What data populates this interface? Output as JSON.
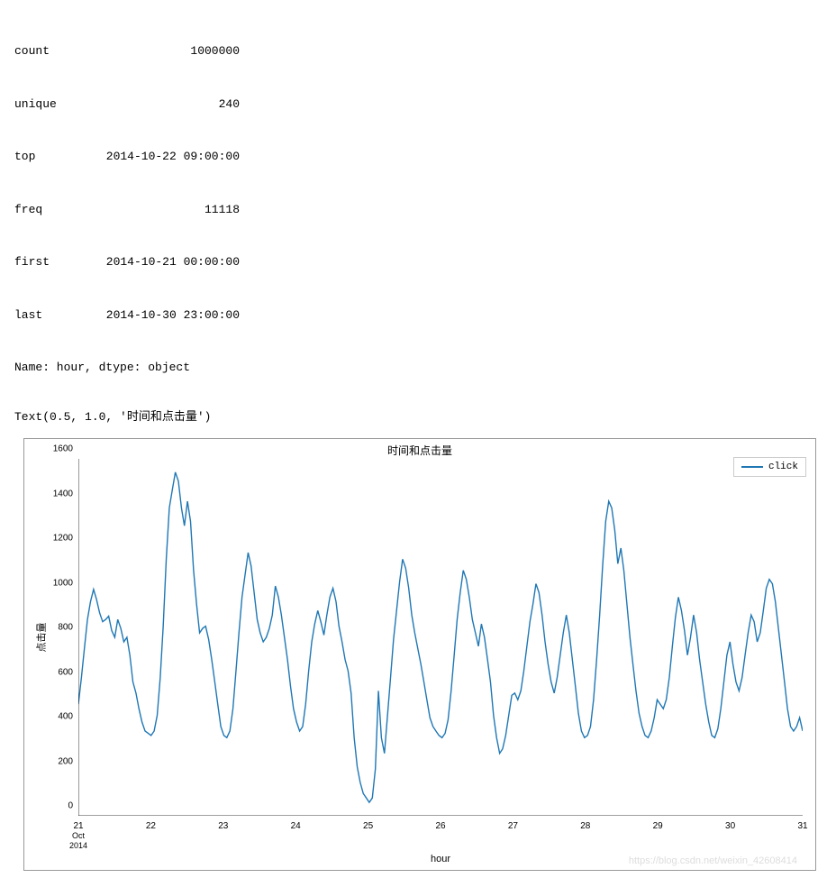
{
  "stats": {
    "count_key": "count",
    "count_val": "1000000",
    "unique_key": "unique",
    "unique_val": "240",
    "top_key": "top",
    "top_val": "2014-10-22 09:00:00",
    "freq_key": "freq",
    "freq_val": "11118",
    "first_key": "first",
    "first_val": "2014-10-21 00:00:00",
    "last_key": "last",
    "last_val": "2014-10-30 23:00:00",
    "name_line": "Name: hour, dtype: object"
  },
  "text_output": "Text(0.5, 1.0, '时间和点击量')",
  "chart": {
    "title": "时间和点击量",
    "xlabel": "hour",
    "ylabel": "点击量",
    "legend_label": "click",
    "watermark": "https://blog.csdn.net/weixin_42608414"
  },
  "chart_data": {
    "type": "line",
    "title": "时间和点击量",
    "xlabel": "hour",
    "ylabel": "点击量",
    "ylim": [
      0,
      1600
    ],
    "xlim": [
      "2014-10-21",
      "2014-10-31"
    ],
    "y_ticks": [
      0,
      200,
      400,
      600,
      800,
      1000,
      1200,
      1400,
      1600
    ],
    "x_ticks": [
      "21",
      "22",
      "23",
      "24",
      "25",
      "26",
      "27",
      "28",
      "29",
      "30",
      "31"
    ],
    "x_tick_sub": [
      "Oct",
      "2014"
    ],
    "series": [
      {
        "name": "click",
        "color": "#1f77b4",
        "x": [
          0,
          1,
          2,
          3,
          4,
          5,
          6,
          7,
          8,
          9,
          10,
          11,
          12,
          13,
          14,
          15,
          16,
          17,
          18,
          19,
          20,
          21,
          22,
          23,
          24,
          25,
          26,
          27,
          28,
          29,
          30,
          31,
          32,
          33,
          34,
          35,
          36,
          37,
          38,
          39,
          40,
          41,
          42,
          43,
          44,
          45,
          46,
          47,
          48,
          49,
          50,
          51,
          52,
          53,
          54,
          55,
          56,
          57,
          58,
          59,
          60,
          61,
          62,
          63,
          64,
          65,
          66,
          67,
          68,
          69,
          70,
          71,
          72,
          73,
          74,
          75,
          76,
          77,
          78,
          79,
          80,
          81,
          82,
          83,
          84,
          85,
          86,
          87,
          88,
          89,
          90,
          91,
          92,
          93,
          94,
          95,
          96,
          97,
          98,
          99,
          100,
          101,
          102,
          103,
          104,
          105,
          106,
          107,
          108,
          109,
          110,
          111,
          112,
          113,
          114,
          115,
          116,
          117,
          118,
          119,
          120,
          121,
          122,
          123,
          124,
          125,
          126,
          127,
          128,
          129,
          130,
          131,
          132,
          133,
          134,
          135,
          136,
          137,
          138,
          139,
          140,
          141,
          142,
          143,
          144,
          145,
          146,
          147,
          148,
          149,
          150,
          151,
          152,
          153,
          154,
          155,
          156,
          157,
          158,
          159,
          160,
          161,
          162,
          163,
          164,
          165,
          166,
          167,
          168,
          169,
          170,
          171,
          172,
          173,
          174,
          175,
          176,
          177,
          178,
          179,
          180,
          181,
          182,
          183,
          184,
          185,
          186,
          187,
          188,
          189,
          190,
          191,
          192,
          193,
          194,
          195,
          196,
          197,
          198,
          199,
          200,
          201,
          202,
          203,
          204,
          205,
          206,
          207,
          208,
          209,
          210,
          211,
          212,
          213,
          214,
          215,
          216,
          217,
          218,
          219,
          220,
          221,
          222,
          223,
          224,
          225,
          226,
          227,
          228,
          229,
          230,
          231,
          232,
          233,
          234,
          235,
          236,
          237,
          238,
          239
        ],
        "values": [
          500,
          620,
          750,
          880,
          960,
          1015,
          970,
          910,
          870,
          880,
          895,
          830,
          800,
          880,
          840,
          780,
          800,
          720,
          600,
          550,
          480,
          420,
          380,
          370,
          360,
          380,
          450,
          620,
          850,
          1150,
          1380,
          1460,
          1540,
          1500,
          1380,
          1300,
          1410,
          1320,
          1100,
          950,
          820,
          840,
          850,
          790,
          700,
          600,
          500,
          400,
          360,
          350,
          380,
          480,
          650,
          820,
          980,
          1080,
          1180,
          1120,
          1000,
          880,
          820,
          780,
          800,
          840,
          900,
          1030,
          980,
          900,
          800,
          700,
          580,
          480,
          420,
          380,
          400,
          500,
          650,
          780,
          860,
          920,
          870,
          810,
          900,
          980,
          1020,
          960,
          850,
          780,
          700,
          650,
          550,
          350,
          220,
          150,
          100,
          80,
          60,
          80,
          210,
          560,
          350,
          280,
          450,
          620,
          790,
          920,
          1050,
          1150,
          1110,
          1020,
          900,
          820,
          750,
          680,
          600,
          520,
          440,
          400,
          380,
          360,
          350,
          370,
          430,
          560,
          720,
          880,
          1000,
          1100,
          1060,
          980,
          880,
          820,
          760,
          860,
          800,
          700,
          600,
          450,
          350,
          280,
          300,
          360,
          450,
          540,
          550,
          520,
          560,
          650,
          760,
          870,
          950,
          1040,
          1000,
          900,
          780,
          680,
          600,
          550,
          620,
          720,
          820,
          900,
          820,
          700,
          580,
          460,
          380,
          350,
          360,
          400,
          520,
          700,
          900,
          1120,
          1320,
          1410,
          1380,
          1280,
          1130,
          1200,
          1100,
          950,
          800,
          680,
          560,
          460,
          400,
          360,
          350,
          380,
          440,
          520,
          500,
          480,
          520,
          620,
          760,
          890,
          980,
          920,
          830,
          720,
          800,
          900,
          820,
          700,
          600,
          500,
          420,
          360,
          350,
          390,
          480,
          600,
          720,
          780,
          680,
          600,
          560,
          620,
          720,
          820,
          900,
          870,
          780,
          820,
          920,
          1020,
          1060,
          1040,
          960,
          840,
          720,
          600,
          480,
          400,
          380,
          400,
          440,
          380
        ]
      }
    ]
  }
}
